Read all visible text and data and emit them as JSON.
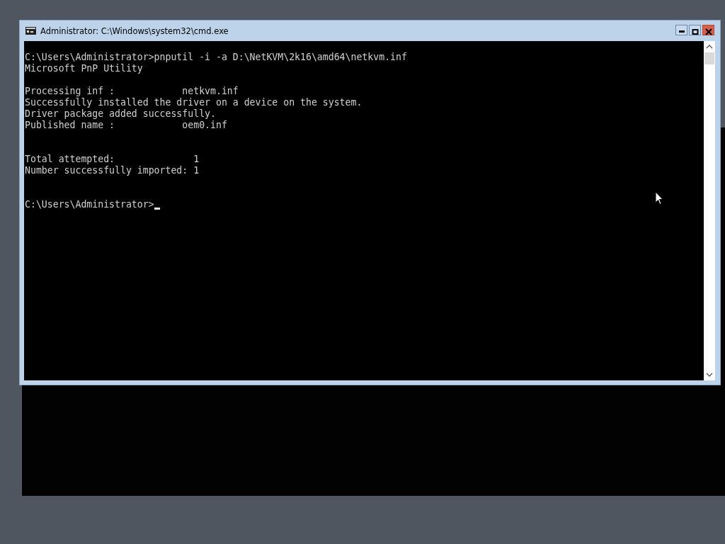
{
  "window": {
    "title": "Administrator: C:\\Windows\\system32\\cmd.exe"
  },
  "console": {
    "output": "C:\\Users\\Administrator>pnputil -i -a D:\\NetKVM\\2k16\\amd64\\netkvm.inf\nMicrosoft PnP Utility\n\nProcessing inf :            netkvm.inf\nSuccessfully installed the driver on a device on the system.\nDriver package added successfully.\nPublished name :            oem0.inf\n\n\nTotal attempted:              1\nNumber successfully imported: 1\n\n",
    "prompt": "C:\\Users\\Administrator>"
  }
}
